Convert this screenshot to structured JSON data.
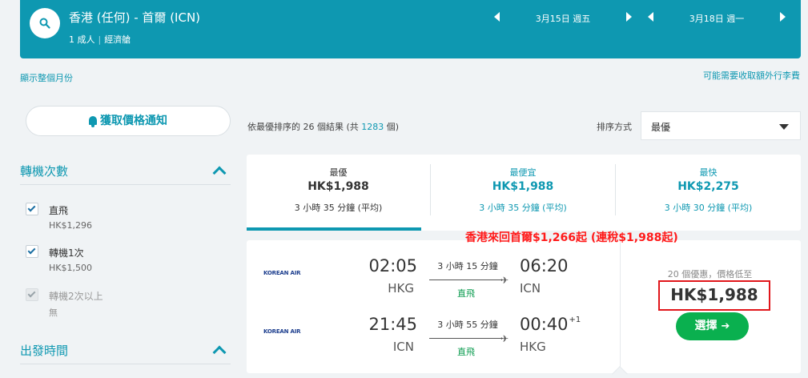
{
  "header": {
    "route": "香港 (任何) - 首爾 (ICN)",
    "passengers": "1 成人",
    "cabin": "經濟艙",
    "outbound_date": "3月15日 週五",
    "return_date": "3月18日 週一"
  },
  "links": {
    "show_month": "顯示整個月份",
    "baggage_fees": "可能需要收取額外行李費"
  },
  "sidebar": {
    "price_alert_label": "獲取價格通知",
    "stops_title": "轉機次數",
    "stops": [
      {
        "label": "直飛",
        "price": "HK$1,296",
        "checked": true,
        "disabled": false
      },
      {
        "label": "轉機1次",
        "price": "HK$1,500",
        "checked": true,
        "disabled": false
      },
      {
        "label": "轉機2次以上",
        "price": "無",
        "checked": true,
        "disabled": true
      }
    ],
    "departure_title": "出發時間"
  },
  "results": {
    "summary_prefix": "依最優排序的 26 個結果 (共 ",
    "total": "1283",
    "summary_suffix": " 個)",
    "sort_label": "排序方式",
    "sort_value": "最優"
  },
  "tabs": [
    {
      "name": "最優",
      "price": "HK$1,988",
      "duration": "3 小時 35 分鐘 (平均)",
      "active": true
    },
    {
      "name": "最便宜",
      "price": "HK$1,988",
      "duration": "3 小時 35 分鐘 (平均)",
      "active": false
    },
    {
      "name": "最快",
      "price": "HK$2,275",
      "duration": "3 小時 30 分鐘 (平均)",
      "active": false
    }
  ],
  "promo": "香港來回首爾$1,266起 (連稅$1,988起)",
  "card": {
    "legs": [
      {
        "airline": "KOREAN AIR",
        "dep_time": "02:05",
        "dep_code": "HKG",
        "duration": "3 小時 15 分鐘",
        "stops": "直飛",
        "arr_time": "06:20",
        "arr_offset": "",
        "arr_code": "ICN"
      },
      {
        "airline": "KOREAN AIR",
        "dep_time": "21:45",
        "dep_code": "ICN",
        "duration": "3 小時 55 分鐘",
        "stops": "直飛",
        "arr_time": "00:40",
        "arr_offset": "+1",
        "arr_code": "HKG"
      }
    ],
    "deals": "20 個優惠，價格低至",
    "price": "HK$1,988",
    "select_label": "選擇"
  },
  "colors": {
    "primary": "#0e98b1",
    "direct_green": "#0b9b4f",
    "select_button": "#0ab04f",
    "promo_red": "#ff1a1a"
  }
}
